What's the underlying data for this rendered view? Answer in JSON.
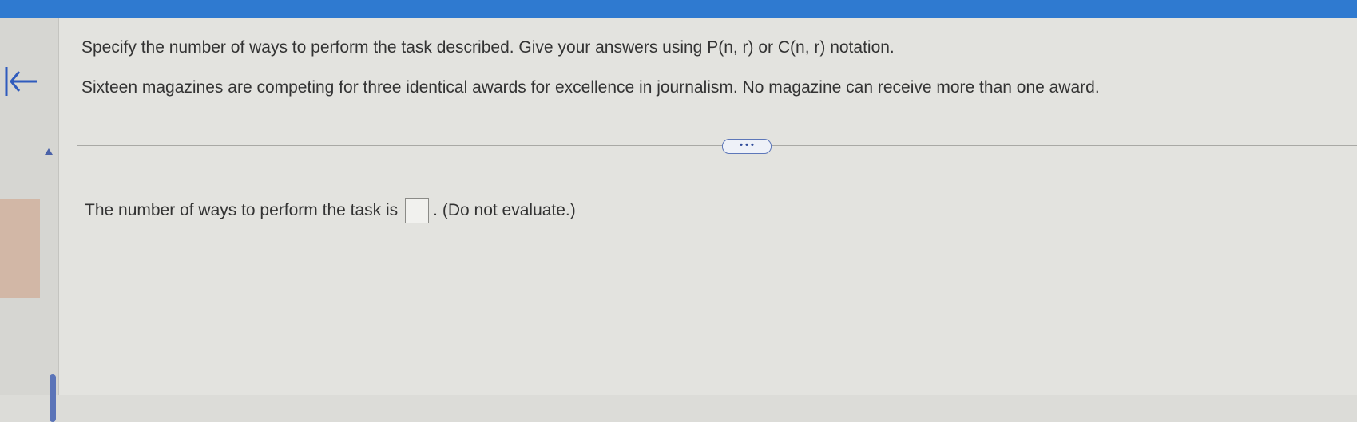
{
  "colors": {
    "accent": "#2f7ad0",
    "panel": "#e3e3df"
  },
  "navigation": {
    "back_icon": "back-to-start-icon",
    "collapse_icon": "triangle-up-icon"
  },
  "question": {
    "instruction": "Specify the number of ways to perform the task described. Give your answers using P(n, r) or C(n, r) notation.",
    "problem": "Sixteen magazines are competing for three identical awards for excellence in journalism. No magazine can receive more than one award."
  },
  "divider": {
    "more_label": "• • •"
  },
  "answer": {
    "prefix": "The number of ways to perform the task is",
    "value": "",
    "suffix": ". (Do not evaluate.)"
  }
}
